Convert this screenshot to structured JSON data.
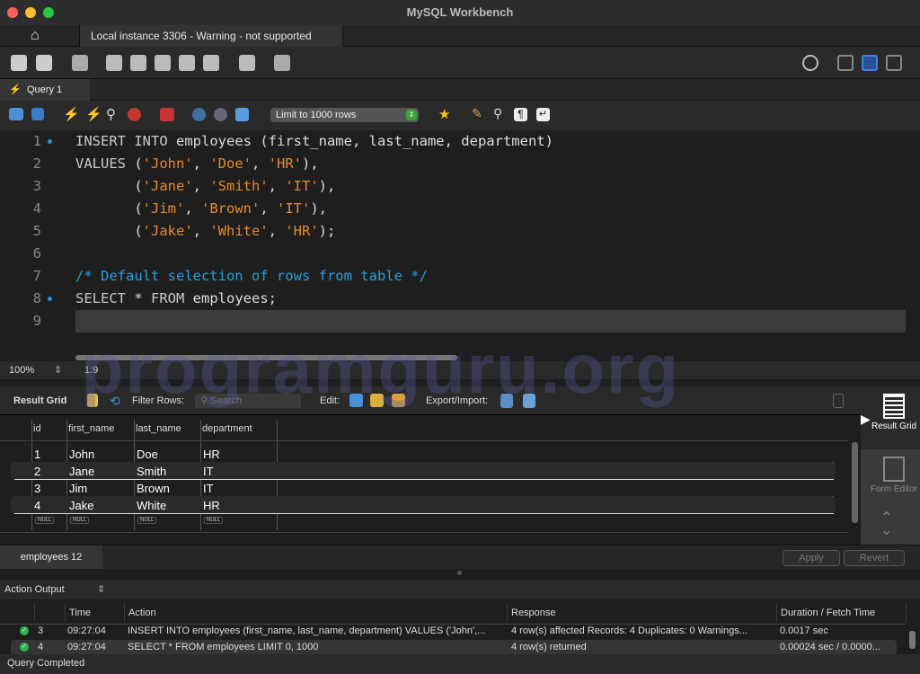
{
  "window": {
    "title": "MySQL Workbench"
  },
  "connection_tab": {
    "label": "Local instance 3306 - Warning - not supported"
  },
  "query_tab": {
    "label": "Query 1"
  },
  "editor_toolbar": {
    "limit_select": "Limit to 1000 rows"
  },
  "editor": {
    "lines": [
      {
        "n": "1",
        "marker": true
      },
      {
        "n": "2"
      },
      {
        "n": "3"
      },
      {
        "n": "4"
      },
      {
        "n": "5"
      },
      {
        "n": "6"
      },
      {
        "n": "7"
      },
      {
        "n": "8",
        "marker": true
      },
      {
        "n": "9"
      }
    ],
    "code": [
      "INSERT INTO employees (first_name, last_name, department)",
      "VALUES ('John', 'Doe', 'HR'),",
      "       ('Jane', 'Smith', 'IT'),",
      "       ('Jim', 'Brown', 'IT'),",
      "       ('Jake', 'White', 'HR');",
      "",
      "/* Default selection of rows from table */",
      "SELECT * FROM employees;",
      ""
    ]
  },
  "editor_status": {
    "zoom": "100%",
    "cursor": "1:9"
  },
  "result_toolbar": {
    "title": "Result Grid",
    "filter_label": "Filter Rows:",
    "search_placeholder": "Search",
    "edit_label": "Edit:",
    "export_label": "Export/Import:"
  },
  "grid": {
    "columns": [
      "id",
      "first_name",
      "last_name",
      "department"
    ],
    "rows": [
      [
        "1",
        "John",
        "Doe",
        "HR"
      ],
      [
        "2",
        "Jane",
        "Smith",
        "IT"
      ],
      [
        "3",
        "Jim",
        "Brown",
        "IT"
      ],
      [
        "4",
        "Jake",
        "White",
        "HR"
      ]
    ],
    "null_label": "NULL"
  },
  "side_panel": {
    "result_grid": "Result Grid",
    "form_editor": "Form Editor"
  },
  "result_tabs": {
    "tab": "employees 12",
    "apply": "Apply",
    "revert": "Revert"
  },
  "output": {
    "selector": "Action Output",
    "columns": [
      "Time",
      "Action",
      "Response",
      "Duration / Fetch Time"
    ],
    "rows": [
      {
        "n": "3",
        "time": "09:27:04",
        "action": "INSERT INTO employees (first_name, last_name, department) VALUES ('John',...",
        "response": "4 row(s) affected Records: 4  Duplicates: 0  Warnings...",
        "duration": "0.0017 sec"
      },
      {
        "n": "4",
        "time": "09:27:04",
        "action": "SELECT * FROM employees LIMIT 0, 1000",
        "response": "4 row(s) returned",
        "duration": "0.00024 sec / 0.0000..."
      }
    ]
  },
  "statusbar": {
    "text": "Query Completed"
  },
  "watermark": "programguru.org",
  "colors": {
    "keyword": "#c9c9c9",
    "string": "#e98a2b",
    "comment": "#2aa0db",
    "accent": "#2f8fe0"
  }
}
